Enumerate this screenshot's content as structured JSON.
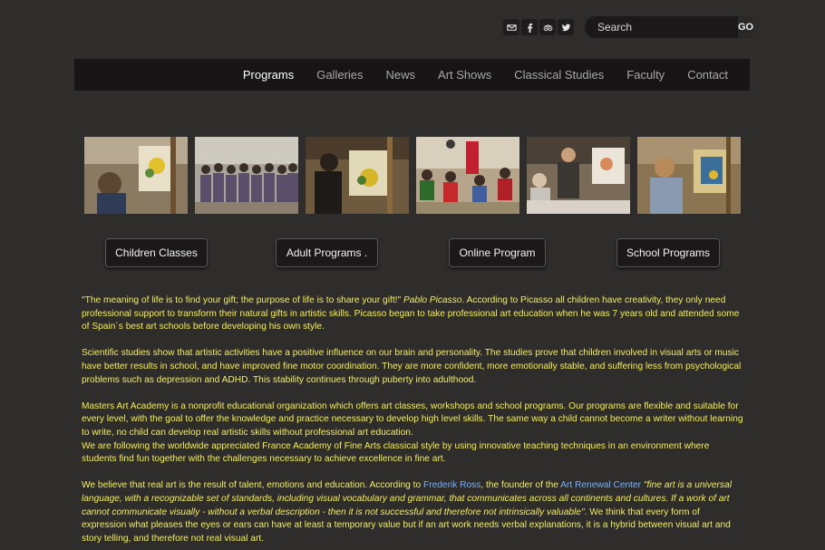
{
  "social": {
    "icons": [
      "email-icon",
      "facebook-icon",
      "tripadvisor-icon",
      "twitter-icon"
    ]
  },
  "search": {
    "placeholder": "Search",
    "button_label": "GO"
  },
  "nav": {
    "items": [
      {
        "label": "Programs",
        "active": true
      },
      {
        "label": "Galleries"
      },
      {
        "label": "News"
      },
      {
        "label": "Art Shows"
      },
      {
        "label": "Classical Studies"
      },
      {
        "label": "Faculty"
      },
      {
        "label": "Contact"
      }
    ]
  },
  "photos": [
    "children-painting-photo",
    "group-photo",
    "adult-painting-photo",
    "classroom-photo",
    "teacher-photo",
    "girl-painting-photo"
  ],
  "programs": [
    {
      "label": "Children Classes"
    },
    {
      "label": "Adult Programs ."
    },
    {
      "label": "Online Program"
    },
    {
      "label": "School Programs"
    }
  ],
  "content": {
    "p1_quote": "\"The meaning of life is to find your gift; the purpose of life is to share your gift!\"",
    "p1_author": "Pablo Picasso",
    "p1_rest": ". According to Picasso all children have creativity, they only need professional support to transform their natural gifts in artistic skills. Picasso began to take professional art education when he was 7 years old and attended some of Spain´s best art schools before developing his own style.",
    "p2": "Scientific studies show that artistic activities have a positive influence on our brain and personality. The studies prove that children involved in visual arts or music have better results in school, and have improved fine motor coordination. They are more confident, more emotionally stable, and suffering less from psychological problems such as depression and ADHD. This stability continues through puberty into adulthood.",
    "p3a": "Masters Art Academy is a nonprofit educational organization which offers art classes, workshops and school programs. Our programs are flexible and suitable for every level, with the goal to offer the knowledge and practice necessary to develop high level skills. The same way a child cannot become a writer without learning to write, no child can develop real artistic skills without professional art education.",
    "p3b": "We are following the worldwide appreciated France Academy of Fine Arts classical style by using innovative teaching techniques in an environment where students find fun together with the challenges necessary to achieve excellence in fine art.",
    "p4_a": "We believe that real art is the result of talent, emotions and education. According to ",
    "p4_link1": "Frederik Ross",
    "p4_b": ", the founder of the ",
    "p4_link2": "Art Renewal Center",
    "p4_quote": " \"fine art is a universal language, with a recognizable set of standards, including visual vocabulary and grammar, that communicates across all continents and cultures. If a work of art cannot communicate visually - without a verbal description - then it is not successful and therefore not intrinsically valuable\"",
    "p4_rest": ". We think that every form of expression what pleases the eyes or ears can have at least a temporary value but if an art work needs verbal explanations, it is a hybrid between visual art and story telling, and therefore not real visual art."
  }
}
